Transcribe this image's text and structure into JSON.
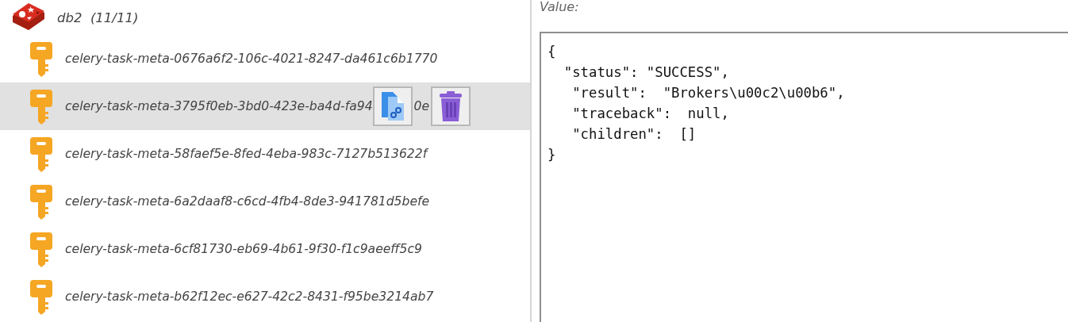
{
  "tree": {
    "database": {
      "name": "db2",
      "count": "(11/11)"
    },
    "keys": [
      {
        "label": "celery-task-meta-0676a6f2-106c-4021-8247-da461c6b1770",
        "selected": false
      },
      {
        "label": "celery-task-meta-3795f0eb-3bd0-423e-ba4d-fa94",
        "selected": true,
        "partial_tail": "0e"
      },
      {
        "label": "celery-task-meta-58faef5e-8fed-4eba-983c-7127b513622f",
        "selected": false
      },
      {
        "label": "celery-task-meta-6a2daaf8-c6cd-4fb4-8de3-941781d5befe",
        "selected": false
      },
      {
        "label": "celery-task-meta-6cf81730-eb69-4b61-9f30-f1c9aeeff5c9",
        "selected": false
      },
      {
        "label": "celery-task-meta-b62f12ec-e627-42c2-8431-f95be3214ab7",
        "selected": false
      }
    ]
  },
  "value_panel": {
    "label": "Value:",
    "lines": [
      "{",
      "  \"status\": \"SUCCESS\",",
      "   \"result\":  \"Brokers\\u00c2\\u00b6\",",
      "   \"traceback\":  null,",
      "   \"children\":  []",
      "}"
    ]
  }
}
